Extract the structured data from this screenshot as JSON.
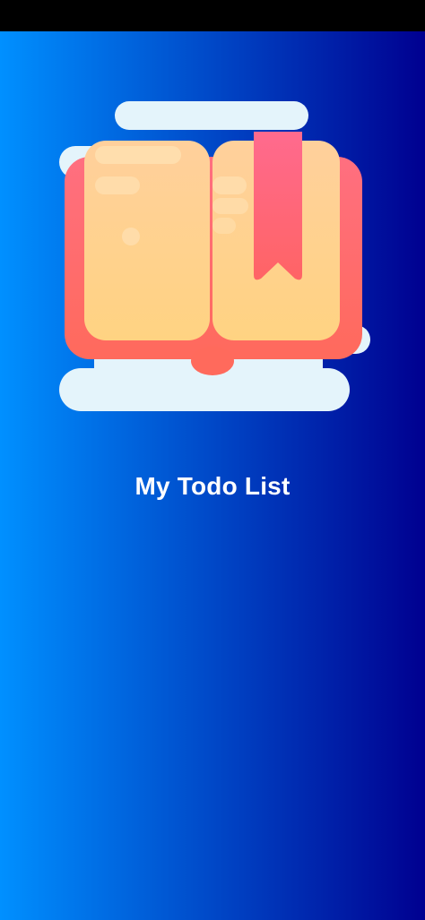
{
  "app": {
    "title": "My Todo List",
    "illustration_icon": "open-book-with-bookmark-icon"
  },
  "colors": {
    "status_bar": "#000000",
    "gradient_left": "#0090FF",
    "gradient_right": "#000090",
    "title_text": "#FFFFFF",
    "cloud": "#E4F4FB",
    "book_cover": "#FF6E6E",
    "book_pages": "#FFD08A",
    "bookmark": "#FF5F7E"
  }
}
